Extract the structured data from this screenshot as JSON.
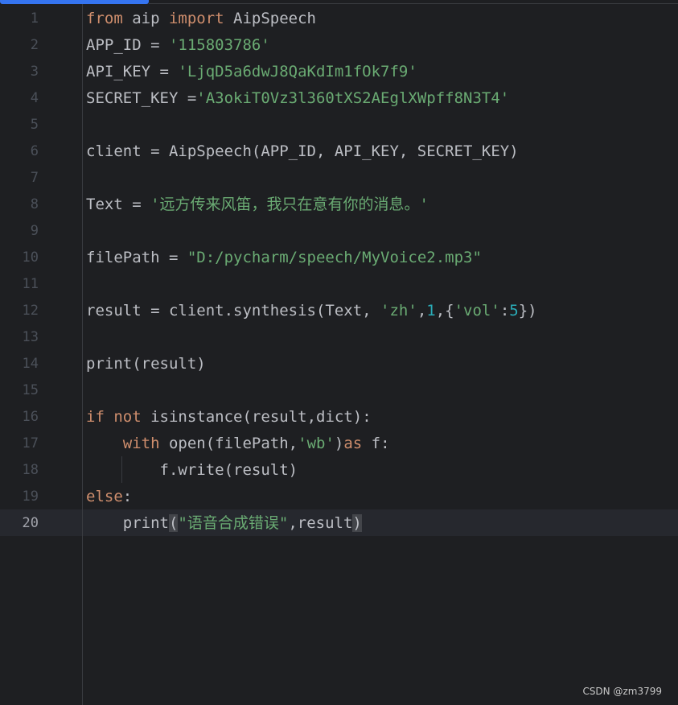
{
  "editor": {
    "active_line": 20,
    "line_numbers": [
      "1",
      "2",
      "3",
      "4",
      "5",
      "6",
      "7",
      "8",
      "9",
      "10",
      "11",
      "12",
      "13",
      "14",
      "15",
      "16",
      "17",
      "18",
      "19",
      "20"
    ]
  },
  "code": {
    "l1": {
      "k1": "from",
      "t1": " aip ",
      "k2": "import",
      "t2": " AipSpeech"
    },
    "l2": {
      "t1": "APP_ID = ",
      "s1": "'115803786'"
    },
    "l3": {
      "t1": "API_KEY = ",
      "s1": "'LjqD5a6dwJ8QaKdIm1fOk7f9'"
    },
    "l4": {
      "t1": "SECRET_KEY =",
      "s1": "'A3okiT0Vz3l360tXS2AEglXWpff8N3T4'"
    },
    "l5": "",
    "l6": {
      "t1": "client = AipSpeech(APP_ID, API_KEY, SECRET_KEY)"
    },
    "l7": "",
    "l8": {
      "t1": "Text = ",
      "s1": "'远方传来风笛，我只在意有你的消息。'"
    },
    "l9": "",
    "l10": {
      "t1": "filePath = ",
      "s1": "\"D:/pycharm/speech/MyVoice2.mp3\""
    },
    "l11": "",
    "l12": {
      "t1": "result = client.synthesis(Text, ",
      "s1": "'zh'",
      "t2": ",",
      "n1": "1",
      "t3": ",{",
      "s2": "'vol'",
      "t4": ":",
      "n2": "5",
      "t5": "})"
    },
    "l13": "",
    "l14": {
      "t1": "print(result)"
    },
    "l15": "",
    "l16": {
      "k1": "if",
      "t1": " ",
      "k2": "not",
      "t2": " isinstance(result,dict):"
    },
    "l17": {
      "indent": "    ",
      "k1": "with",
      "t1": " open(filePath,",
      "s1": "'wb'",
      "t2": ")",
      "k2": "as",
      "t3": " f:"
    },
    "l18": {
      "indent": "        ",
      "t1": "f.write(result)"
    },
    "l19": {
      "k1": "else",
      "t1": ":"
    },
    "l20": {
      "indent": "    ",
      "t1": "print",
      "p1": "(",
      "s1": "\"语音合成错误\"",
      "t2": ",result",
      "p2": ")"
    }
  },
  "watermark": "CSDN @zm3799"
}
